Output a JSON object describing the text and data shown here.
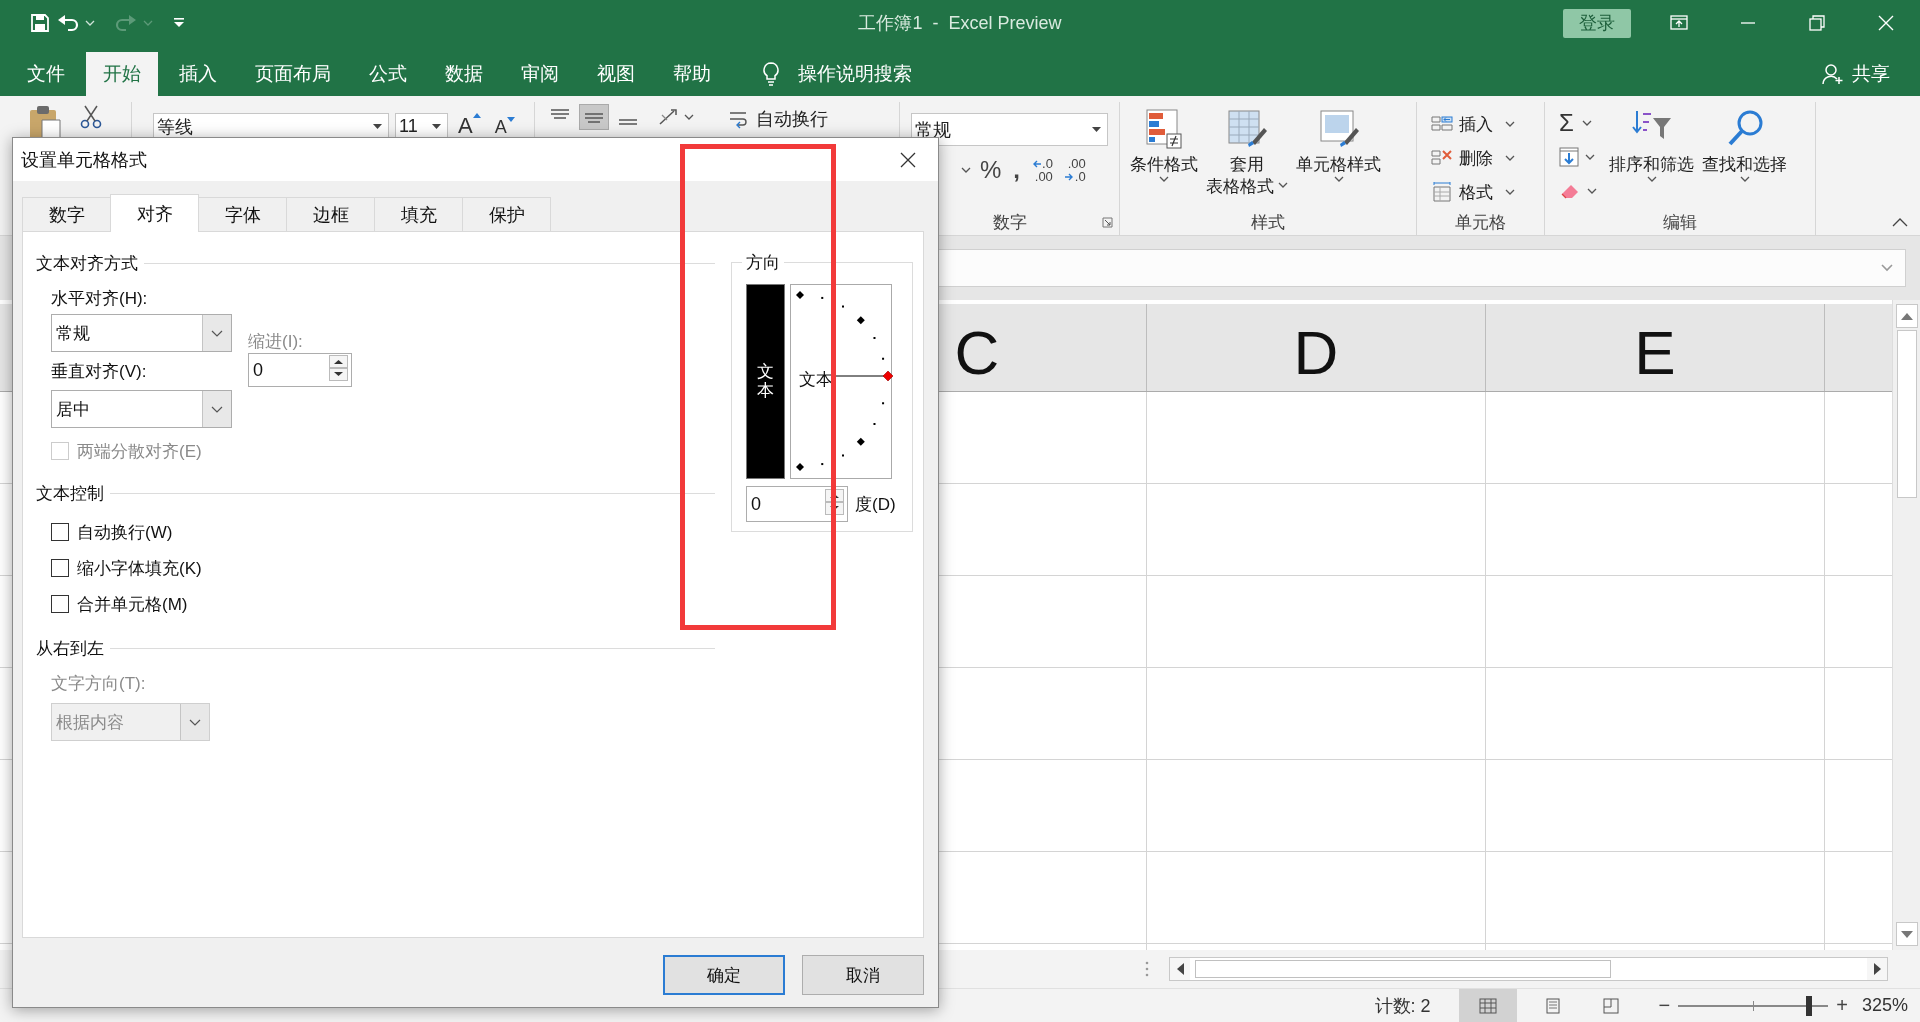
{
  "window": {
    "title": "工作簿1  -  Excel Preview",
    "sign_in": "登录"
  },
  "quick_access": [
    {
      "kind": "save",
      "disabled": false
    },
    {
      "kind": "undo",
      "disabled": false
    },
    {
      "kind": "redo",
      "disabled": true
    },
    {
      "kind": "customize",
      "disabled": false
    }
  ],
  "ribbon_tabs": [
    {
      "label": "文件",
      "selected": false
    },
    {
      "label": "开始",
      "selected": true
    },
    {
      "label": "插入",
      "selected": false
    },
    {
      "label": "页面布局",
      "selected": false
    },
    {
      "label": "公式",
      "selected": false
    },
    {
      "label": "数据",
      "selected": false
    },
    {
      "label": "审阅",
      "selected": false
    },
    {
      "label": "视图",
      "selected": false
    },
    {
      "label": "帮助",
      "selected": false
    }
  ],
  "tell_me": "操作说明搜索",
  "share": "共享",
  "ribbon": {
    "font_name": "等线",
    "font_size": "11",
    "font_buttons": [
      "A",
      "A"
    ],
    "wrap_text": "自动换行",
    "number": {
      "format": "常规",
      "buttons": [
        {
          "kind": "percent",
          "lines": [
            "%"
          ]
        },
        {
          "kind": "comma",
          "lines": [
            ","
          ]
        },
        {
          "kind": "increase_decimal",
          "lines": [
            ".0",
            ".00"
          ]
        },
        {
          "kind": "decrease_decimal",
          "lines": [
            ".00",
            ".0"
          ]
        }
      ],
      "label": "数字"
    },
    "styles": {
      "buttons": [
        {
          "kind": "conditional",
          "lines": [
            "条件格式"
          ]
        },
        {
          "kind": "table",
          "lines": [
            "套用",
            "表格格式"
          ]
        },
        {
          "kind": "cell_style",
          "lines": [
            "单元格样式"
          ]
        }
      ],
      "label": "样式"
    },
    "cells": {
      "buttons": [
        {
          "kind": "insert",
          "label": "插入"
        },
        {
          "kind": "delete",
          "label": "删除"
        },
        {
          "kind": "format",
          "label": "格式"
        }
      ],
      "label": "单元格"
    },
    "editing": {
      "sum": "Σ",
      "buttons": [
        {
          "kind": "sort",
          "label": "排序和筛选"
        },
        {
          "kind": "find",
          "label": "查找和选择"
        }
      ],
      "label": "编辑"
    }
  },
  "sheet": {
    "columns": [
      "C",
      "D",
      "E"
    ]
  },
  "status_bar": {
    "count": "计数: 2",
    "views": [
      {
        "kind": "normal",
        "selected": true
      },
      {
        "kind": "page_layout",
        "selected": false
      },
      {
        "kind": "page_break",
        "selected": false
      }
    ],
    "zoom_out": "−",
    "zoom_in": "+",
    "zoom": {
      "level": 0.87,
      "reading": "325%"
    }
  },
  "dialog": {
    "title": "设置单元格格式",
    "tabs": [
      {
        "label": "数字",
        "selected": false
      },
      {
        "label": "对齐",
        "selected": true
      },
      {
        "label": "字体",
        "selected": false
      },
      {
        "label": "边框",
        "selected": false
      },
      {
        "label": "填充",
        "selected": false
      },
      {
        "label": "保护",
        "selected": false
      }
    ],
    "text_alignment": {
      "heading": "文本对齐方式",
      "horizontal": {
        "label": "水平对齐(H):",
        "value": "常规"
      },
      "vertical": {
        "label": "垂直对齐(V):",
        "value": "居中"
      },
      "indent": {
        "label": "缩进(I):",
        "value": "0"
      },
      "distributed": {
        "label": "两端分散对齐(E)",
        "checked": false,
        "disabled": true
      }
    },
    "text_control": {
      "heading": "文本控制",
      "options": [
        {
          "label": "自动换行(W)",
          "checked": false,
          "disabled": false
        },
        {
          "label": "缩小字体填充(K)",
          "checked": false,
          "disabled": false
        },
        {
          "label": "合并单元格(M)",
          "checked": false,
          "disabled": false
        }
      ]
    },
    "right_to_left": {
      "heading": "从右到左",
      "direction": {
        "label": "文字方向(T):",
        "value": "根据内容",
        "disabled": true
      }
    },
    "orientation": {
      "heading": "方向",
      "vertical_text": "文本",
      "dial_text": "文本",
      "degrees": "0",
      "degrees_label": "度(D)"
    },
    "buttons": [
      {
        "label": "确定",
        "default": true
      },
      {
        "label": "取消",
        "default": false
      }
    ]
  }
}
